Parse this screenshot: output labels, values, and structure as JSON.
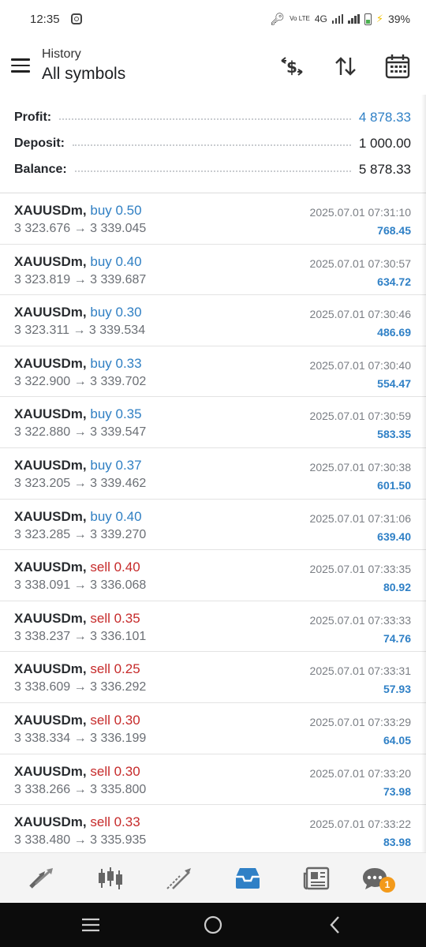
{
  "status": {
    "time": "12:35",
    "volte": "Vo LTE",
    "network": "4G",
    "battery_pct": "39%"
  },
  "header": {
    "subtitle": "History",
    "title": "All symbols"
  },
  "summary": [
    {
      "label": "Profit:",
      "value": "4 878.33",
      "accent": true
    },
    {
      "label": "Deposit:",
      "value": "1 000.00",
      "accent": false
    },
    {
      "label": "Balance:",
      "value": "5 878.33",
      "accent": false
    }
  ],
  "deals": [
    {
      "symbol": "XAUUSDm,",
      "type": "buy 0.50",
      "side": "buy",
      "open": "3 323.676",
      "close": "3 339.045",
      "time": "2025.07.01 07:31:10",
      "profit": "768.45"
    },
    {
      "symbol": "XAUUSDm,",
      "type": "buy 0.40",
      "side": "buy",
      "open": "3 323.819",
      "close": "3 339.687",
      "time": "2025.07.01 07:30:57",
      "profit": "634.72"
    },
    {
      "symbol": "XAUUSDm,",
      "type": "buy 0.30",
      "side": "buy",
      "open": "3 323.311",
      "close": "3 339.534",
      "time": "2025.07.01 07:30:46",
      "profit": "486.69"
    },
    {
      "symbol": "XAUUSDm,",
      "type": "buy 0.33",
      "side": "buy",
      "open": "3 322.900",
      "close": "3 339.702",
      "time": "2025.07.01 07:30:40",
      "profit": "554.47"
    },
    {
      "symbol": "XAUUSDm,",
      "type": "buy 0.35",
      "side": "buy",
      "open": "3 322.880",
      "close": "3 339.547",
      "time": "2025.07.01 07:30:59",
      "profit": "583.35"
    },
    {
      "symbol": "XAUUSDm,",
      "type": "buy 0.37",
      "side": "buy",
      "open": "3 323.205",
      "close": "3 339.462",
      "time": "2025.07.01 07:30:38",
      "profit": "601.50"
    },
    {
      "symbol": "XAUUSDm,",
      "type": "buy 0.40",
      "side": "buy",
      "open": "3 323.285",
      "close": "3 339.270",
      "time": "2025.07.01 07:31:06",
      "profit": "639.40"
    },
    {
      "symbol": "XAUUSDm,",
      "type": "sell 0.40",
      "side": "sell",
      "open": "3 338.091",
      "close": "3 336.068",
      "time": "2025.07.01 07:33:35",
      "profit": "80.92"
    },
    {
      "symbol": "XAUUSDm,",
      "type": "sell 0.35",
      "side": "sell",
      "open": "3 338.237",
      "close": "3 336.101",
      "time": "2025.07.01 07:33:33",
      "profit": "74.76"
    },
    {
      "symbol": "XAUUSDm,",
      "type": "sell 0.25",
      "side": "sell",
      "open": "3 338.609",
      "close": "3 336.292",
      "time": "2025.07.01 07:33:31",
      "profit": "57.93"
    },
    {
      "symbol": "XAUUSDm,",
      "type": "sell 0.30",
      "side": "sell",
      "open": "3 338.334",
      "close": "3 336.199",
      "time": "2025.07.01 07:33:29",
      "profit": "64.05"
    },
    {
      "symbol": "XAUUSDm,",
      "type": "sell 0.30",
      "side": "sell",
      "open": "3 338.266",
      "close": "3 335.800",
      "time": "2025.07.01 07:33:20",
      "profit": "73.98"
    },
    {
      "symbol": "XAUUSDm,",
      "type": "sell 0.33",
      "side": "sell",
      "open": "3 338.480",
      "close": "3 335.935",
      "time": "2025.07.01 07:33:22",
      "profit": "83.98"
    }
  ],
  "arrow": "→",
  "nav": {
    "items": [
      {
        "name": "quotes",
        "icon": "quotes-arrows-icon"
      },
      {
        "name": "chart",
        "icon": "candlestick-icon"
      },
      {
        "name": "trade",
        "icon": "trade-line-icon"
      },
      {
        "name": "history",
        "icon": "inbox-tray-icon",
        "active": true
      },
      {
        "name": "news",
        "icon": "newspaper-icon"
      },
      {
        "name": "messages",
        "icon": "chat-bubble-icon"
      }
    ],
    "messages_badge": "1",
    "active_color": "#2f80c6"
  },
  "colors": {
    "buy": "#2f7fc3",
    "sell": "#c62a2a",
    "profit": "#2f80c6"
  }
}
